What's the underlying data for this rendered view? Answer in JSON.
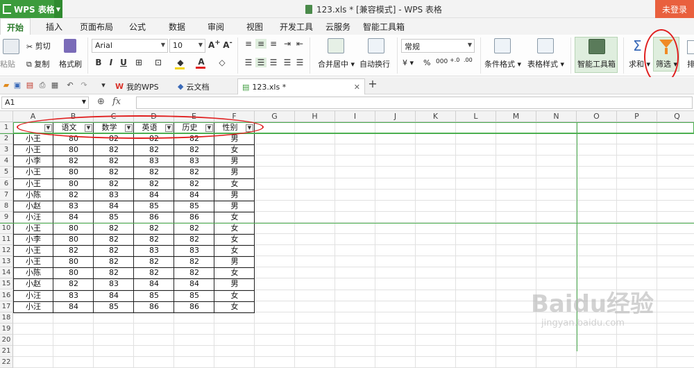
{
  "titlebar": {
    "app_name": "WPS 表格",
    "doc_title": "123.xls * [兼容模式] - WPS 表格",
    "login": "未登录"
  },
  "menu": {
    "tabs": [
      "开始",
      "插入",
      "页面布局",
      "公式",
      "数据",
      "审阅",
      "视图",
      "开发工具",
      "云服务",
      "智能工具箱"
    ]
  },
  "ribbon": {
    "cut": "剪切",
    "paste": "粘贴",
    "copy": "复制",
    "format_painter": "格式刷",
    "font_name": "Arial",
    "font_size": "10",
    "merge_center": "合并居中",
    "wrap_text": "自动换行",
    "number_format": "常规",
    "conditional_format": "条件格式",
    "table_style": "表格样式",
    "smart_toolbox": "智能工具箱",
    "sum": "求和",
    "filter": "筛选",
    "sort": "排序",
    "percent": "%",
    "thousands": "000",
    "inc_decimal": "+.0",
    "dec_decimal": ".00"
  },
  "docbar": {
    "tabs": [
      {
        "label": "我的WPS",
        "active": false
      },
      {
        "label": "云文档",
        "active": false
      },
      {
        "label": "123.xls *",
        "active": true
      }
    ]
  },
  "formula": {
    "cell_ref": "A1",
    "fx": "fx",
    "value": ""
  },
  "grid": {
    "columns": [
      "A",
      "B",
      "C",
      "D",
      "E",
      "F",
      "G",
      "H",
      "I",
      "J",
      "K",
      "L",
      "M",
      "N",
      "O",
      "P",
      "Q"
    ],
    "header_row": [
      "",
      "语文",
      "数学",
      "英语",
      "历史",
      "性别"
    ],
    "rows": [
      [
        "小王",
        "80",
        "82",
        "82",
        "82",
        "男"
      ],
      [
        "小王",
        "80",
        "82",
        "82",
        "82",
        "女"
      ],
      [
        "小李",
        "82",
        "82",
        "83",
        "83",
        "男"
      ],
      [
        "小王",
        "80",
        "82",
        "82",
        "82",
        "男"
      ],
      [
        "小王",
        "80",
        "82",
        "82",
        "82",
        "女"
      ],
      [
        "小陈",
        "82",
        "83",
        "84",
        "84",
        "男"
      ],
      [
        "小赵",
        "83",
        "84",
        "85",
        "85",
        "男"
      ],
      [
        "小汪",
        "84",
        "85",
        "86",
        "86",
        "女"
      ],
      [
        "小王",
        "80",
        "82",
        "82",
        "82",
        "女"
      ],
      [
        "小李",
        "80",
        "82",
        "82",
        "82",
        "女"
      ],
      [
        "小王",
        "82",
        "82",
        "83",
        "83",
        "女"
      ],
      [
        "小王",
        "80",
        "82",
        "82",
        "82",
        "男"
      ],
      [
        "小陈",
        "80",
        "82",
        "82",
        "82",
        "女"
      ],
      [
        "小赵",
        "82",
        "83",
        "84",
        "84",
        "男"
      ],
      [
        "小汪",
        "83",
        "84",
        "85",
        "85",
        "女"
      ],
      [
        "小汪",
        "84",
        "85",
        "86",
        "86",
        "女"
      ]
    ],
    "row_numbers": [
      "1",
      "2",
      "3",
      "4",
      "5",
      "6",
      "7",
      "8",
      "9",
      "10",
      "11",
      "12",
      "13",
      "14",
      "15",
      "16",
      "17",
      "18",
      "19",
      "20",
      "21",
      "22"
    ]
  },
  "watermark": {
    "brand": "Baidu经验",
    "url": "jingyan.baidu.com"
  },
  "colors": {
    "accent_green": "#3c9b3c",
    "login_orange": "#e9603e",
    "annotation_red": "#e02020"
  }
}
